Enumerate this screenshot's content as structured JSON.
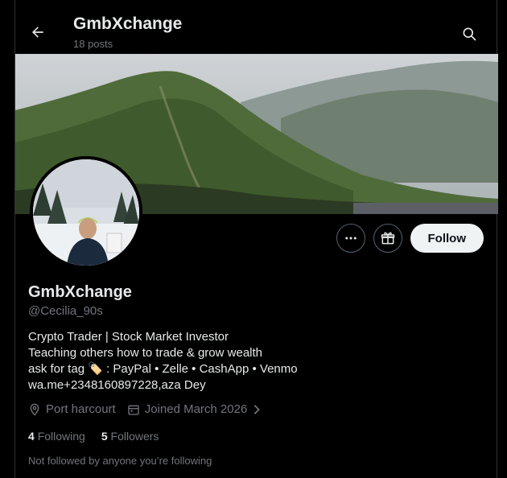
{
  "header": {
    "title": "GmbXchange",
    "posts_count": "18 posts"
  },
  "profile": {
    "name": "GmbXchange",
    "handle": "@Cecilia_90s",
    "bio_lines": [
      "Crypto Trader | Stock Market Investor",
      "Teaching others how to trade & grow wealth",
      "ask for tag 🏷️ : PayPal • Zelle • CashApp • Venmo",
      "wa.me+2348160897228,aza Dey"
    ],
    "location": "Port harcourt",
    "joined": "Joined March 2026"
  },
  "actions": {
    "more_icon": "more-icon",
    "gift_icon": "gift-icon",
    "follow_label": "Follow"
  },
  "stats": {
    "following_count": "4",
    "following_label": "Following",
    "followers_count": "5",
    "followers_label": "Followers"
  },
  "social_context": "Not followed by anyone you’re following",
  "colors": {
    "background": "#000000",
    "text_primary": "#e7e9ea",
    "text_secondary": "#71767b",
    "border": "#2f3336",
    "follow_bg": "#eff3f4"
  }
}
